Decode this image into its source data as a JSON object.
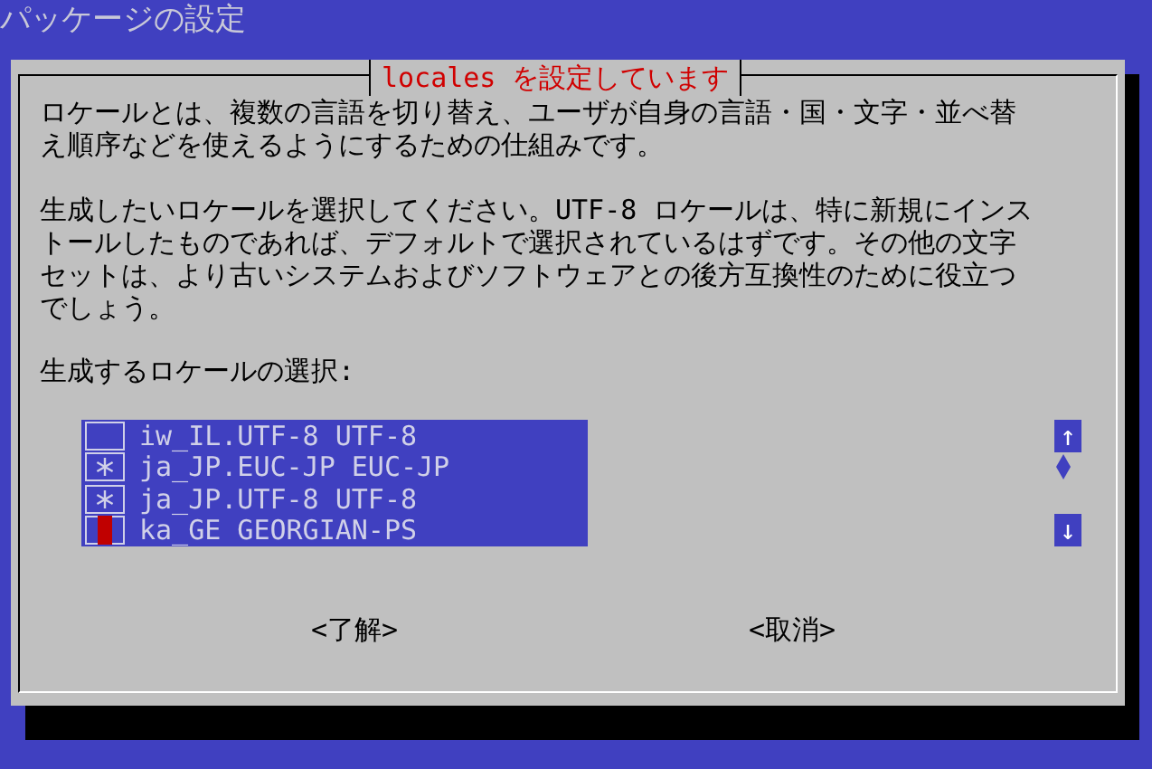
{
  "screen_title": "パッケージの設定",
  "dialog": {
    "title": "locales を設定しています",
    "paragraphs": [
      [
        "ロケールとは、複数の言語を切り替え、ユーザが自身の言語・国・文字・並べ替",
        "え順序などを使えるようにするための仕組みです。"
      ],
      [
        "生成したいロケールを選択してください。UTF-8 ロケールは、特に新規にインス",
        "トールしたものであれば、デフォルトで選択されているはずです。その他の文字",
        "セットは、より古いシステムおよびソフトウェアとの後方互換性のために役立つ",
        "でしょう。"
      ]
    ],
    "list_label": "生成するロケールの選択:",
    "items": [
      {
        "label": "iw_IL.UTF-8 UTF-8",
        "checked": false,
        "focused": false
      },
      {
        "label": "ja_JP.EUC-JP EUC-JP",
        "checked": true,
        "focused": false
      },
      {
        "label": "ja_JP.UTF-8 UTF-8",
        "checked": true,
        "focused": false
      },
      {
        "label": "ka_GE GEORGIAN-PS",
        "checked": false,
        "focused": true
      }
    ],
    "scroll_up": "↑",
    "scroll_down": "↓",
    "buttons": [
      {
        "label": "<了解>"
      },
      {
        "label": "<取消>"
      }
    ]
  }
}
